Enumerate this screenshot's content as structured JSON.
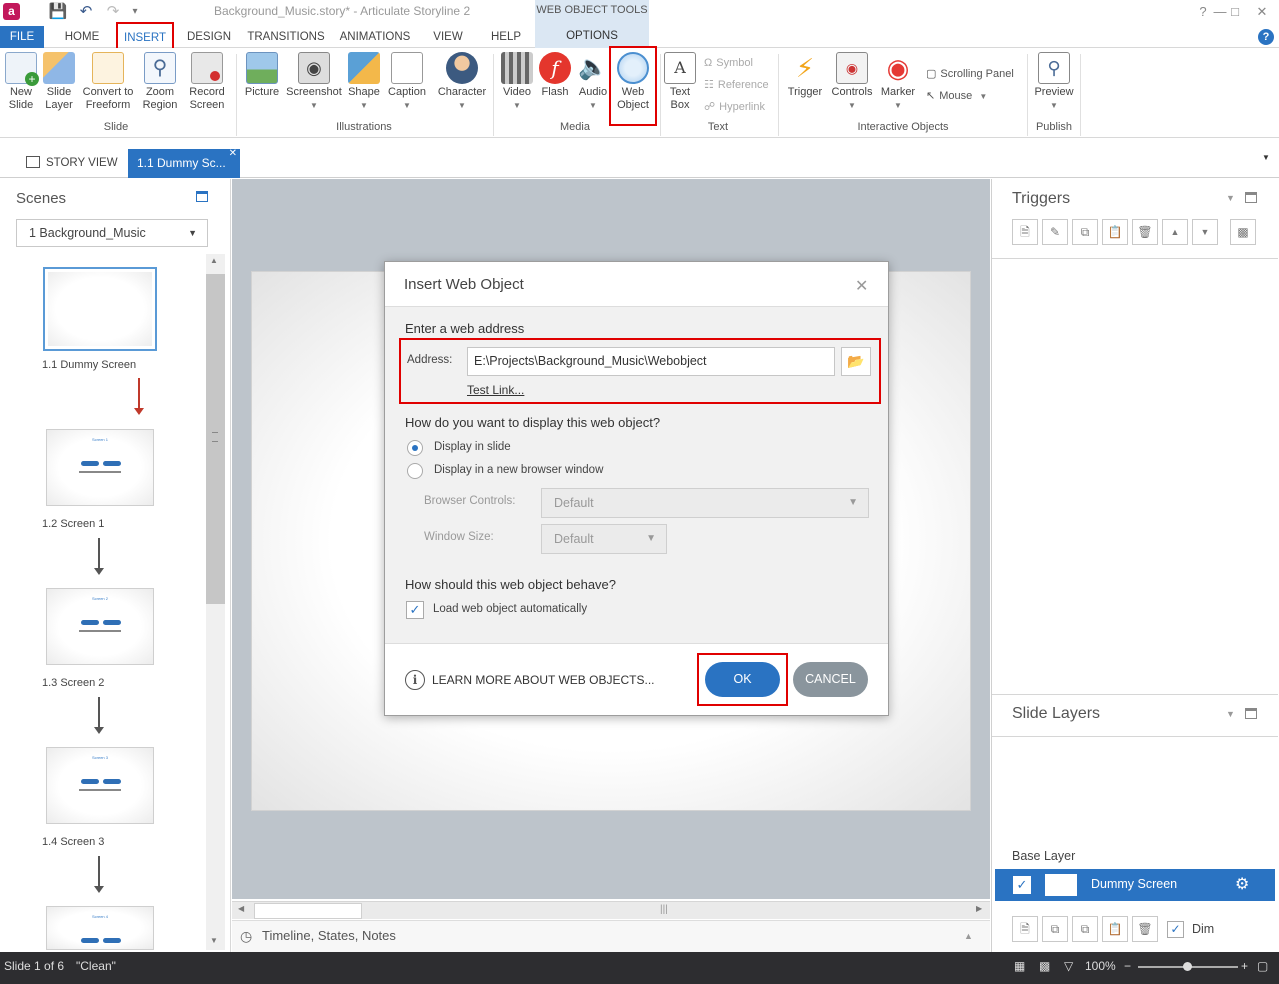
{
  "window": {
    "title": "Background_Music.story* -  Articulate Storyline 2",
    "contextual_tab_group": "WEB OBJECT TOOLS",
    "contextual_tab": "OPTIONS"
  },
  "tabs": [
    "FILE",
    "HOME",
    "INSERT",
    "DESIGN",
    "TRANSITIONS",
    "ANIMATIONS",
    "VIEW",
    "HELP"
  ],
  "ribbon": {
    "slide_group": {
      "label": "Slide",
      "new_slide": "New\nSlide",
      "slide_layer": "Slide\nLayer",
      "convert": "Convert to\nFreeform",
      "zoom": "Zoom\nRegion",
      "record": "Record\nScreen"
    },
    "illustrations_group": {
      "label": "Illustrations",
      "picture": "Picture",
      "screenshot": "Screenshot",
      "shape": "Shape",
      "caption": "Caption",
      "character": "Character"
    },
    "media_group": {
      "label": "Media",
      "video": "Video",
      "flash": "Flash",
      "audio": "Audio",
      "web_object": "Web\nObject"
    },
    "text_group": {
      "label": "Text",
      "text_box": "Text\nBox",
      "symbol": "Symbol",
      "reference": "Reference",
      "hyperlink": "Hyperlink"
    },
    "interactive_group": {
      "label": "Interactive Objects",
      "trigger": "Trigger",
      "controls": "Controls",
      "marker": "Marker",
      "scrolling_panel": "Scrolling Panel",
      "mouse": "Mouse"
    },
    "publish_group": {
      "label": "Publish",
      "preview": "Preview"
    }
  },
  "doc_tabs": {
    "story_view": "STORY VIEW",
    "current": "1.1 Dummy Sc..."
  },
  "scenes": {
    "title": "Scenes",
    "selected_scene": "1 Background_Music",
    "slides": [
      {
        "caption": "1.1 Dummy Screen"
      },
      {
        "caption": "1.2 Screen 1",
        "heading": "Screen 1"
      },
      {
        "caption": "1.3 Screen 2",
        "heading": "Screen 2"
      },
      {
        "caption": "1.4 Screen 3",
        "heading": "Screen 3"
      },
      {
        "caption": "",
        "heading": "Screen 4"
      }
    ]
  },
  "timeline_label": "Timeline, States, Notes",
  "triggers": {
    "title": "Triggers"
  },
  "slide_layers": {
    "title": "Slide Layers",
    "base_layer_label": "Base Layer",
    "base_layer_name": "Dummy Screen",
    "dim_label": "Dim"
  },
  "status": {
    "slide_info": "Slide 1 of 6",
    "theme": "\"Clean\"",
    "zoom": "100%"
  },
  "dialog": {
    "title": "Insert Web Object",
    "section_address": "Enter a web address",
    "address_label": "Address:",
    "address_value": "E:\\Projects\\Background_Music\\Webobject",
    "test_link": "Test Link...",
    "section_display": "How do you want to display this web object?",
    "option_in_slide": "Display in slide",
    "option_new_window": "Display in a new browser window",
    "browser_controls_label": "Browser Controls:",
    "browser_controls_value": "Default",
    "window_size_label": "Window Size:",
    "window_size_value": "Default",
    "section_behave": "How should this web object behave?",
    "load_auto_label": "Load web object automatically",
    "learn_more": "LEARN MORE ABOUT WEB OBJECTS...",
    "ok": "OK",
    "cancel": "CANCEL"
  },
  "colors": {
    "accent": "#2a73c2",
    "highlight": "#e00000",
    "statusbar": "#2d2d30"
  }
}
